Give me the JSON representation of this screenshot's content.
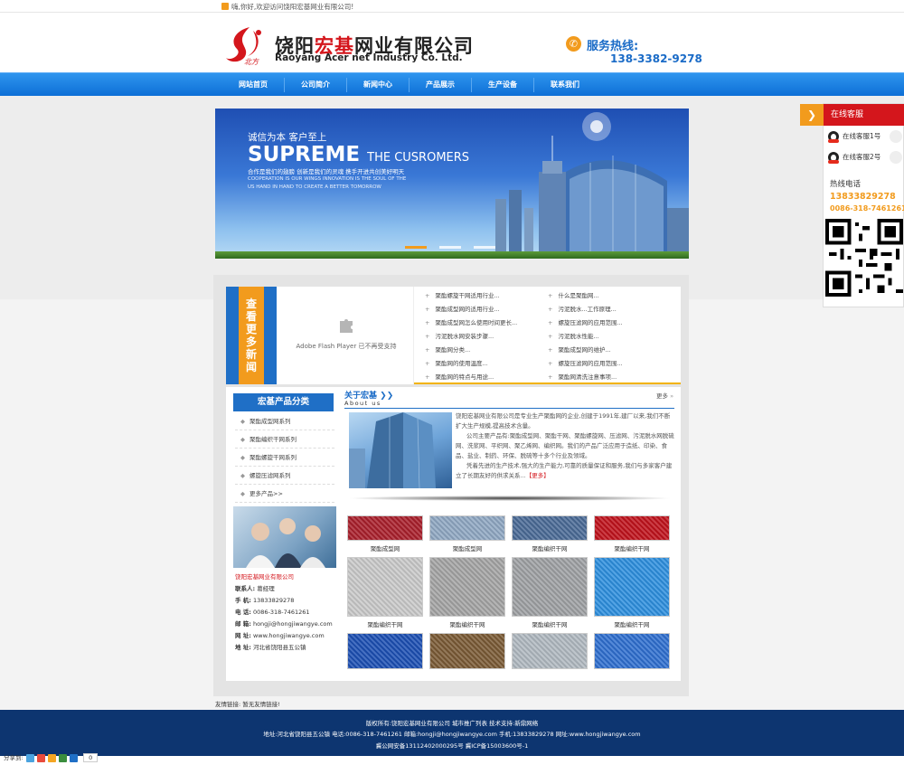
{
  "topbar": {
    "welcome": "嗨,你好,欢迎访问饶阳宏基网业有限公司!"
  },
  "header": {
    "company_cn_part1": "饶阳",
    "company_cn_highlight": "宏基",
    "company_cn_part2": "网业有限公司",
    "company_en": "Raoyang Acer net Industry Co. Ltd.",
    "logo_mark_text": "北方",
    "hotline_label": "服务热线:",
    "hotline_number": "138-3382-9278"
  },
  "nav": {
    "items": [
      {
        "label": "网站首页"
      },
      {
        "label": "公司简介"
      },
      {
        "label": "新闻中心"
      },
      {
        "label": "产品展示"
      },
      {
        "label": "生产设备"
      },
      {
        "label": "联系我们"
      }
    ]
  },
  "banner": {
    "slogan": "诚信为本 客户至上",
    "title": "SUPREME",
    "title_sub": "THE CUSROMERS",
    "line1": "合作是我们的翅膀 创新是我们的灵魂 携手开进共创美好明天",
    "line2": "COOPERATION IS OUR WINGS INNOVATION IS THE SOUL OF THE",
    "line3": "US HAND IN HAND TO CREATE A BETTER TOMORROW"
  },
  "news": {
    "tag": "查看更多新闻",
    "flash_message": "Adobe Flash Player 已不再受支持",
    "col1": [
      "聚酯螺旋干网适用行业...",
      "聚酯成型网的适用行业...",
      "聚酯成型网怎么使用时间更长...",
      "污泥脱水网安装步骤...",
      "聚酯网分类...",
      "聚酯网的使用温度...",
      "聚酯网的特点与用途..."
    ],
    "col2": [
      "什么是聚酯网...",
      "污泥脱水...工作原理...",
      "螺旋压滤网的应用范围...",
      "污泥脱水性能...",
      "聚酯成型网的维护...",
      "螺旋压滤网的应用范围...",
      "聚酯网清洗注意事项..."
    ]
  },
  "categories": {
    "title": "宏基产品分类",
    "items": [
      "聚酯成型网系列",
      "聚酯编织干网系列",
      "聚酯螺旋干网系列",
      "螺旋压滤网系列",
      "更多产品>>"
    ]
  },
  "contact": {
    "company": "饶阳宏基网业有限公司",
    "person_label": "联系人:",
    "person": "葛经理",
    "mobile_label": "手 机:",
    "mobile": "13833829278",
    "phone_label": "电 话:",
    "phone": "0086-318-7461261",
    "email_label": "邮 箱:",
    "email": "hongji@hongjiwangye.com",
    "web_label": "网 址:",
    "web": "www.hongjiwangye.com",
    "address_label": "地 址:",
    "address": "河北省饶阳县五公镇"
  },
  "about": {
    "title": "关于宏基",
    "subtitle": "About us",
    "more": "更多",
    "p1": "饶阳宏基网业有限公司是专业生产聚酯网的企业,创建于1991年,建厂以来,我们不断扩大生产规模,提高技术含量。",
    "p2": "公司主要产品有:聚酯成型网、聚酯干网、聚酯螺旋网、压滤网、污泥脱水网脱硫网、洗浆网、平织网、聚乙烯网、编织网。我们的产品广泛应用于造纸、印染、食品、盐业、制药、环保、脱硫等十多个行业及领域。",
    "p3": "凭着先进的生产技术,强大的生产能力,可靠的质量保证和服务,我们与多家客户建立了长期友好的供求关系...",
    "p3_more": "【更多】"
  },
  "products": [
    {
      "caption": "聚酯成型网",
      "color": "#a91f2b"
    },
    {
      "caption": "聚酯成型网",
      "color": "#8fa7c2"
    },
    {
      "caption": "聚酯编织干网",
      "color": "#4a6a96"
    },
    {
      "caption": "聚酯编织干网",
      "color": "#c0121c"
    },
    {
      "caption": "聚酯编织干网",
      "color": "#c9c9c9"
    },
    {
      "caption": "聚酯编织干网",
      "color": "#a4a4a4"
    },
    {
      "caption": "聚酯编织干网",
      "color": "#9ea0a3"
    },
    {
      "caption": "聚酯编织干网",
      "color": "#2d8fde"
    },
    {
      "caption": "",
      "color": "#1c4fb3"
    },
    {
      "caption": "",
      "color": "#7a5a35"
    },
    {
      "caption": "",
      "color": "#b0b8c0"
    },
    {
      "caption": "",
      "color": "#2f6fcf"
    }
  ],
  "friend_links": "友情链接: 暂无友情链接!",
  "footer": {
    "line1": "版权所有:饶阳宏基网业有限公司 城市推广列表 技术支持:新鼎网络",
    "line2": "地址:河北省饶阳县五公镇 电话:0086-318-7461261 邮箱:hongji@hongjiwangye.com 手机:13833829278 网址:www.hongjiwangye.com",
    "line3": "冀公网安备13112402000295号 冀ICP备15003600号-1"
  },
  "share": {
    "label": "分享到:",
    "count": "0"
  },
  "service": {
    "title": "在线客服",
    "qq1": "在线客服1号",
    "qq2": "在线客服2号",
    "hotline_title": "热线电话",
    "hotline1": "13833829278",
    "hotline2": "0086-318-7461261"
  },
  "colors": {
    "brand_blue": "#1f6fc6",
    "accent_orange": "#f29b1d",
    "brand_red": "#d4161c",
    "footer_navy": "#0d3570"
  }
}
